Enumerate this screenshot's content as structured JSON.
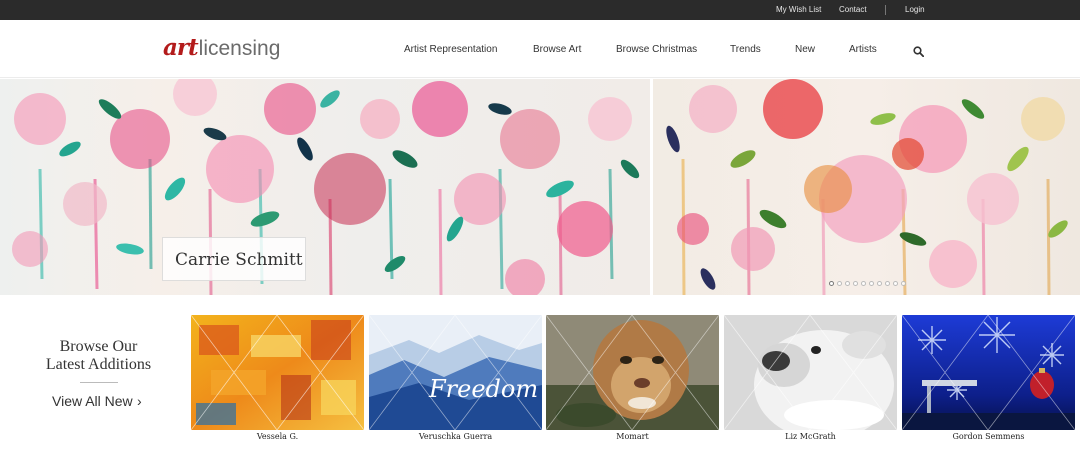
{
  "topbar": {
    "wishlist": "My Wish List",
    "contact": "Contact",
    "login": "Login"
  },
  "logo": {
    "art": "art",
    "licensing": "licensing"
  },
  "nav": {
    "items": [
      "Artist Representation",
      "Browse Art",
      "Browse Christmas",
      "Trends",
      "New",
      "Artists"
    ],
    "search_icon": "search-icon"
  },
  "hero": {
    "caption": "Carrie Schmitt",
    "dots": 10,
    "active_dot": 0
  },
  "browse": {
    "title_line1": "Browse Our",
    "title_line2": "Latest Additions",
    "view_all": "View All New",
    "chevron": "›"
  },
  "thumbnails": [
    {
      "artist": "Vessela G."
    },
    {
      "artist": "Veruschka Guerra",
      "image_text": "Freedom"
    },
    {
      "artist": "Momart"
    },
    {
      "artist": "Liz McGrath"
    },
    {
      "artist": "Gordon Semmens"
    }
  ],
  "colors": {
    "topbar_bg": "#2b2b2b",
    "brand_red": "#b31b1b"
  }
}
